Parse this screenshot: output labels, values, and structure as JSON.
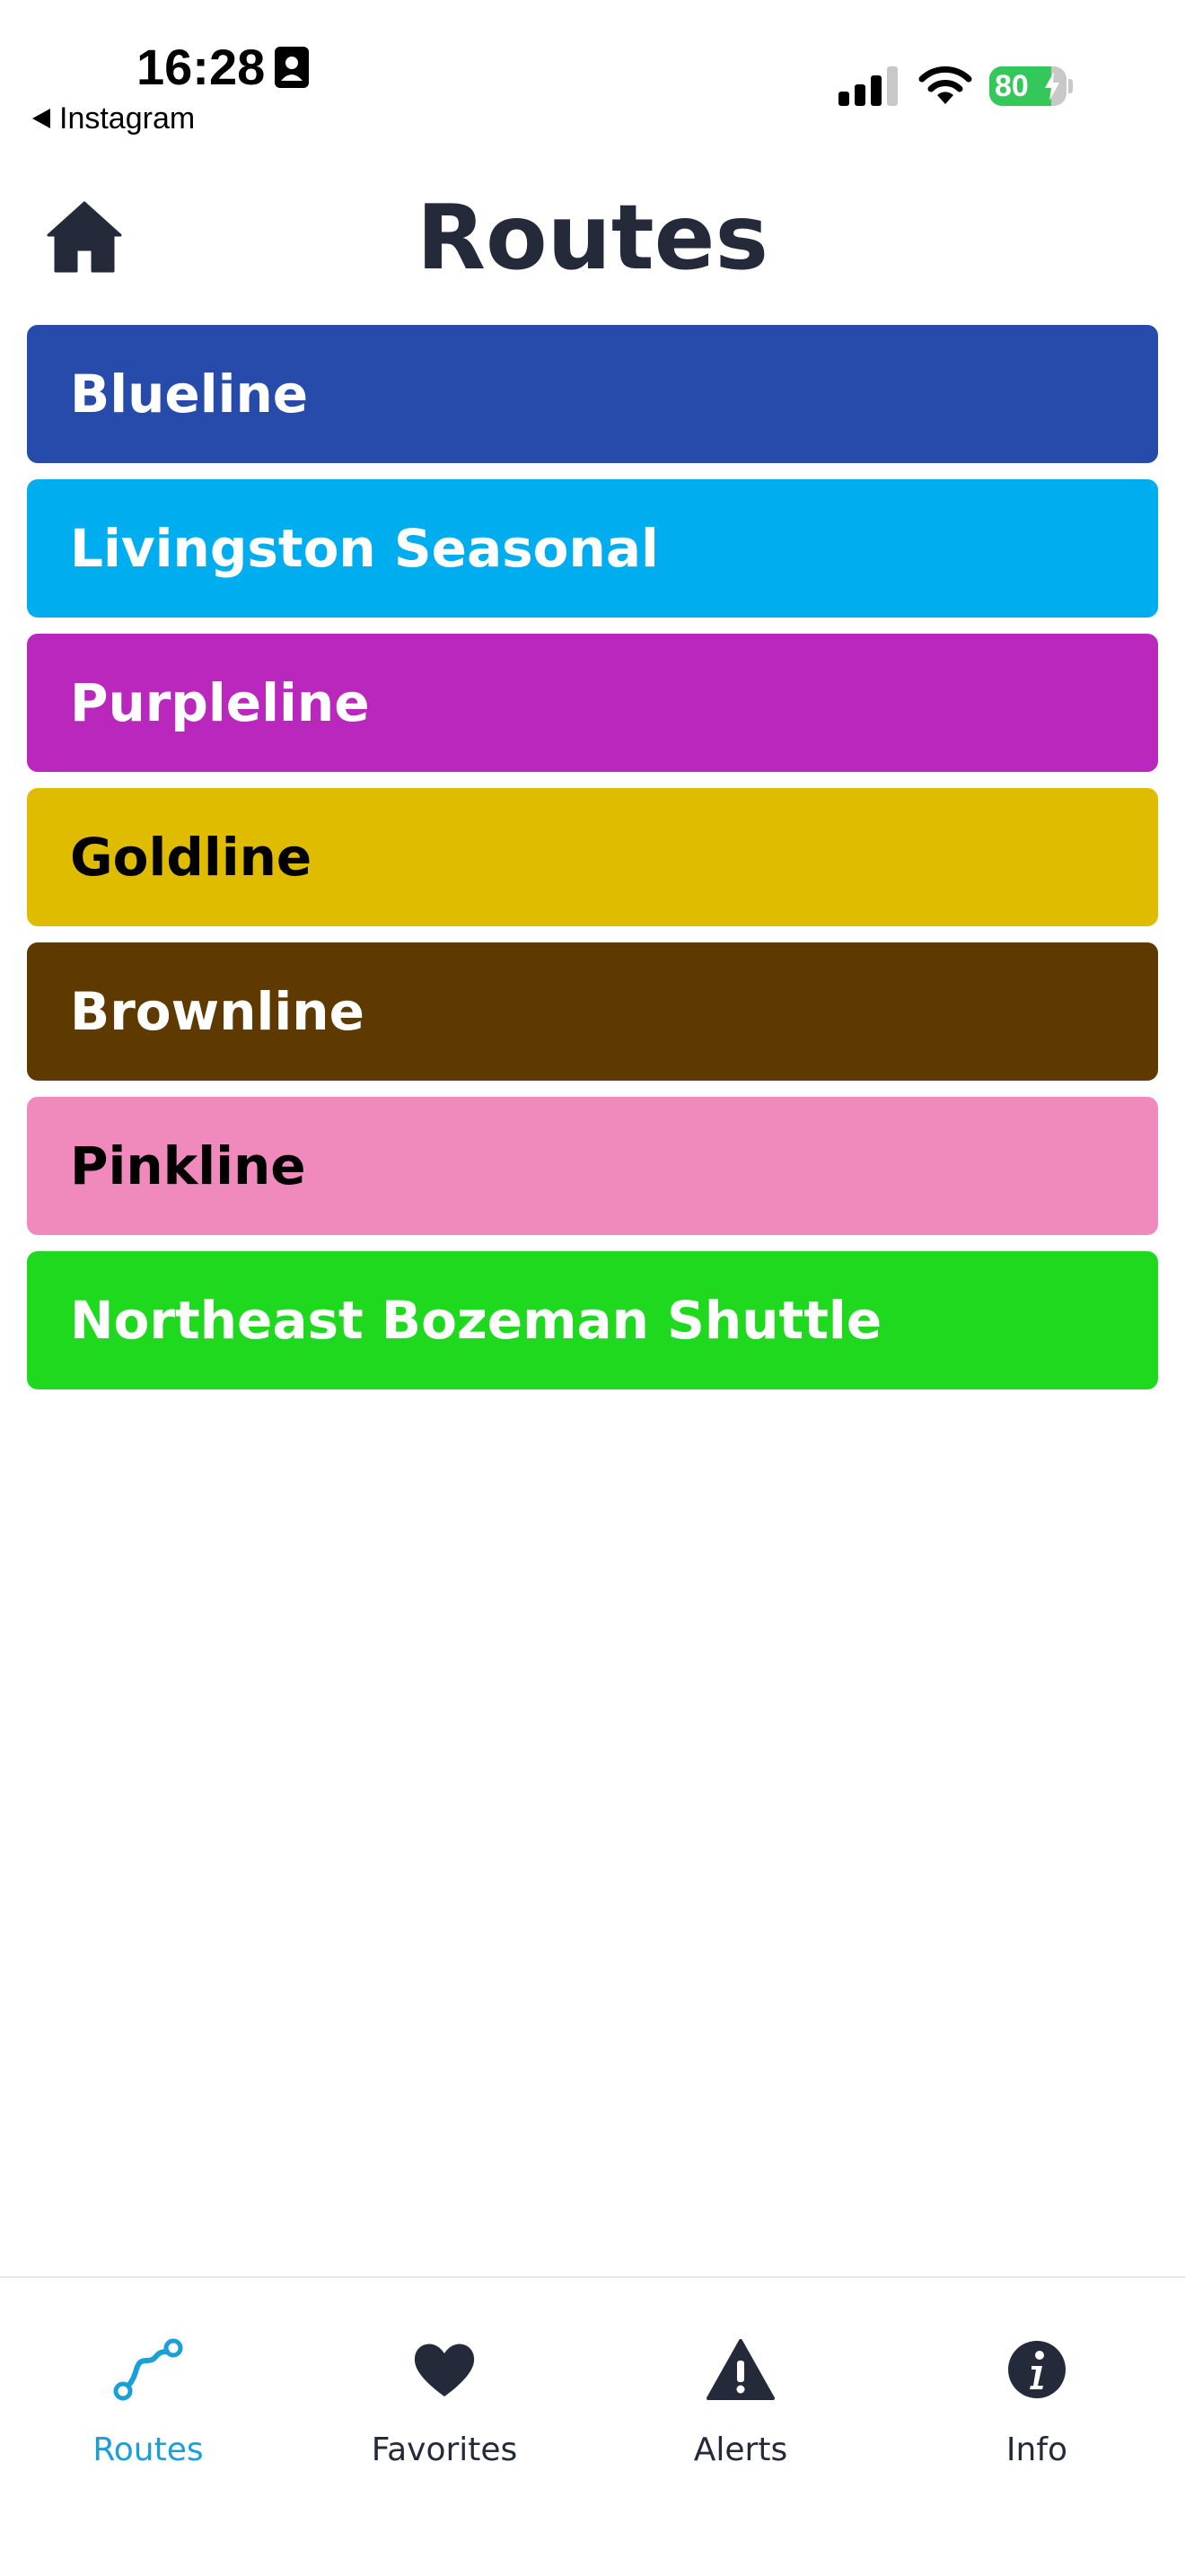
{
  "status_bar": {
    "time": "16:28",
    "back_app": "Instagram",
    "battery": "80",
    "battery_level": 0.8
  },
  "header": {
    "title": "Routes"
  },
  "routes": [
    {
      "name": "Blueline",
      "color": "#274bab",
      "text_color": "#ffffff"
    },
    {
      "name": "Livingston Seasonal",
      "color": "#00adef",
      "text_color": "#ffffff"
    },
    {
      "name": "Purpleline",
      "color": "#b927bd",
      "text_color": "#ffffff"
    },
    {
      "name": "Goldline",
      "color": "#dfbc00",
      "text_color": "#000000"
    },
    {
      "name": "Brownline",
      "color": "#5e3a00",
      "text_color": "#ffffff"
    },
    {
      "name": "Pinkline",
      "color": "#f089bc",
      "text_color": "#000000"
    },
    {
      "name": "Northeast Bozeman Shuttle",
      "color": "#1fd91f",
      "text_color": "#ffffff"
    }
  ],
  "tabs": [
    {
      "label": "Routes",
      "icon": "route-icon",
      "active": true
    },
    {
      "label": "Favorites",
      "icon": "heart-icon",
      "active": false
    },
    {
      "label": "Alerts",
      "icon": "alert-triangle-icon",
      "active": false
    },
    {
      "label": "Info",
      "icon": "info-icon",
      "active": false
    }
  ],
  "colors": {
    "title": "#252a3a",
    "tab_active": "#1aa0d8",
    "tab_inactive": "#252a3a"
  }
}
